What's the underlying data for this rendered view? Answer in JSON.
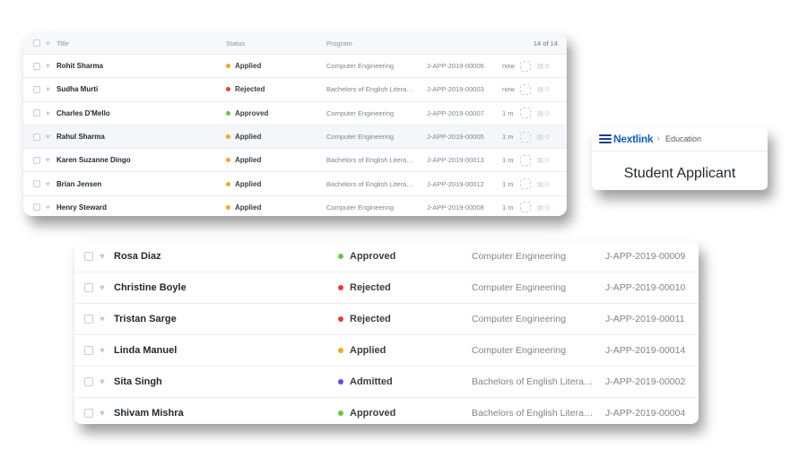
{
  "list_small": {
    "header": {
      "title": "Title",
      "status": "Status",
      "program": "Program",
      "count": "14 of 14"
    },
    "rows": [
      {
        "name": "Rohit Sharma",
        "status": "Applied",
        "status_color": "#f5a623",
        "program": "Computer Engineering",
        "id": "J-APP-2019-00006",
        "time": "now",
        "comments": "0"
      },
      {
        "name": "Sudha Murti",
        "status": "Rejected",
        "status_color": "#e53e3e",
        "program": "Bachelors of English Litera…",
        "id": "J-APP-2019-00003",
        "time": "now",
        "comments": "0"
      },
      {
        "name": "Charles D'Mello",
        "status": "Approved",
        "status_color": "#6cc24a",
        "program": "Computer Engineering",
        "id": "J-APP-2019-00007",
        "time": "1 m",
        "comments": "0"
      },
      {
        "name": "Rahul Sharma",
        "status": "Applied",
        "status_color": "#f5a623",
        "program": "Computer Engineering",
        "id": "J-APP-2019-00005",
        "time": "1 m",
        "comments": "0"
      },
      {
        "name": "Karen Suzanne Dingo",
        "status": "Applied",
        "status_color": "#f5a623",
        "program": "Bachelors of English Litera…",
        "id": "J-APP-2019-00013",
        "time": "1 m",
        "comments": "0"
      },
      {
        "name": "Brian Jensen",
        "status": "Applied",
        "status_color": "#f5a623",
        "program": "Bachelors of English Litera…",
        "id": "J-APP-2019-00012",
        "time": "1 m",
        "comments": "0"
      },
      {
        "name": "Henry Steward",
        "status": "Applied",
        "status_color": "#f5a623",
        "program": "Computer Engineering",
        "id": "J-APP-2019-00008",
        "time": "1 m",
        "comments": "0"
      }
    ]
  },
  "list_large": {
    "rows": [
      {
        "name": "Rosa Diaz",
        "status": "Approved",
        "status_color": "#6cc24a",
        "program": "Computer Engineering",
        "id": "J-APP-2019-00009"
      },
      {
        "name": "Christine Boyle",
        "status": "Rejected",
        "status_color": "#e53e3e",
        "program": "Computer Engineering",
        "id": "J-APP-2019-00010"
      },
      {
        "name": "Tristan Sarge",
        "status": "Rejected",
        "status_color": "#e53e3e",
        "program": "Computer Engineering",
        "id": "J-APP-2019-00011"
      },
      {
        "name": "Linda Manuel",
        "status": "Applied",
        "status_color": "#f5a623",
        "program": "Computer Engineering",
        "id": "J-APP-2019-00014"
      },
      {
        "name": "Sita Singh",
        "status": "Admitted",
        "status_color": "#5b4ce6",
        "program": "Bachelors of English Litera…",
        "id": "J-APP-2019-00002"
      },
      {
        "name": "Shivam Mishra",
        "status": "Approved",
        "status_color": "#6cc24a",
        "program": "Bachelors of English Litera…",
        "id": "J-APP-2019-00004"
      }
    ]
  },
  "breadcrumb_card": {
    "logo_text": "Nextlink",
    "crumb_separator": "›",
    "crumb_label": "Education",
    "page_title": "Student Applicant"
  },
  "icons": {
    "heart": "heart-icon",
    "checkbox": "checkbox-icon",
    "comment": "comment-icon",
    "avatar": "avatar-placeholder"
  }
}
